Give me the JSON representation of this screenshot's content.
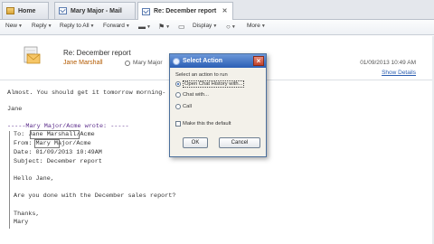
{
  "tabs": [
    {
      "label": "Home",
      "icon": "home-icon"
    },
    {
      "label": "Mary Major - Mail",
      "icon": "mail-icon"
    },
    {
      "label": "Re: December report",
      "icon": "mail-icon"
    }
  ],
  "toolbar": {
    "new": "New",
    "reply": "Reply",
    "reply_all": "Reply to All",
    "forward": "Forward",
    "display": "Display",
    "more": "More"
  },
  "message": {
    "subject": "Re: December report",
    "sender": "Jane Marshall",
    "recipient": "Mary Major",
    "date": "01/09/2013 10:49 AM",
    "show_details": "Show Details"
  },
  "body": {
    "line1": "Almost. You should get it tomorrow morning-",
    "signoff": "Jane",
    "quote_header": "-----Mary Major/Acme wrote: -----",
    "quote_to": "To: Jane Marshall/Acme",
    "quote_from": "From: Mary Major/Acme",
    "quote_date": "Date: 01/09/2013 10:49AM",
    "quote_subject": "Subject: December report",
    "greeting": "Hello Jane,",
    "question": "Are you done with the December sales report?",
    "thanks": "Thanks,",
    "name": "Mary"
  },
  "dialog": {
    "title": "Select Action",
    "prompt": "Select an action to run",
    "options": [
      "Open Chat History with...",
      "Chat with...",
      "Call"
    ],
    "selected_index": 0,
    "checkbox_label": "Make this the default",
    "ok": "OK",
    "cancel": "Cancel"
  }
}
